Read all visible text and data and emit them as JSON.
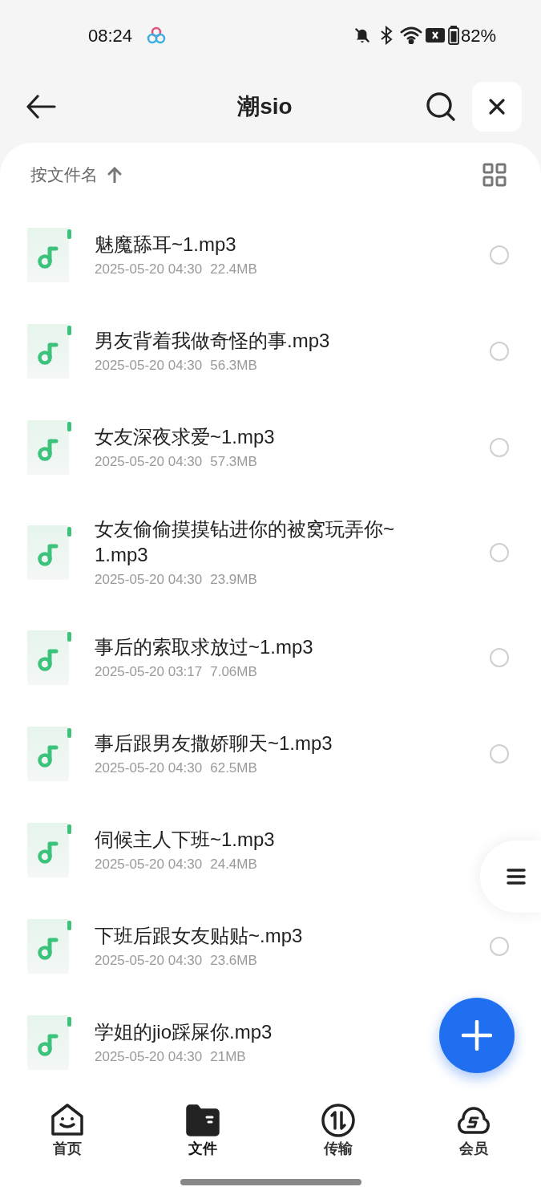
{
  "status_bar": {
    "time": "08:24",
    "battery": "82%"
  },
  "header": {
    "title": "潮sio"
  },
  "sort": {
    "label": "按文件名"
  },
  "files": [
    {
      "name": "魅魔舔耳~1.mp3",
      "date": "2025-05-20 04:30",
      "size": "22.4MB",
      "selected": false
    },
    {
      "name": "男友背着我做奇怪的事.mp3",
      "date": "2025-05-20 04:30",
      "size": "56.3MB",
      "selected": false
    },
    {
      "name": "女友深夜求爱~1.mp3",
      "date": "2025-05-20 04:30",
      "size": "57.3MB",
      "selected": false
    },
    {
      "name": "女友偷偷摸摸钻进你的被窝玩弄你~1.mp3",
      "date": "2025-05-20 04:30",
      "size": "23.9MB",
      "selected": false
    },
    {
      "name": "事后的索取求放过~1.mp3",
      "date": "2025-05-20 03:17",
      "size": "7.06MB",
      "selected": false
    },
    {
      "name": "事后跟男友撒娇聊天~1.mp3",
      "date": "2025-05-20 04:30",
      "size": "62.5MB",
      "selected": false
    },
    {
      "name": "伺候主人下班~1.mp3",
      "date": "2025-05-20 04:30",
      "size": "24.4MB"
    },
    {
      "name": "下班后跟女友贴贴~.mp3",
      "date": "2025-05-20 04:30",
      "size": "23.6MB",
      "selected": false
    },
    {
      "name": "学姐的jio踩屎你.mp3",
      "date": "2025-05-20 04:30",
      "size": "21MB"
    }
  ],
  "nav": [
    {
      "label": "首页",
      "kind": "home",
      "selected": false
    },
    {
      "label": "文件",
      "kind": "files",
      "selected": true
    },
    {
      "label": "传输",
      "kind": "transfer",
      "selected": false
    },
    {
      "label": "会员",
      "kind": "vip",
      "selected": false
    }
  ]
}
